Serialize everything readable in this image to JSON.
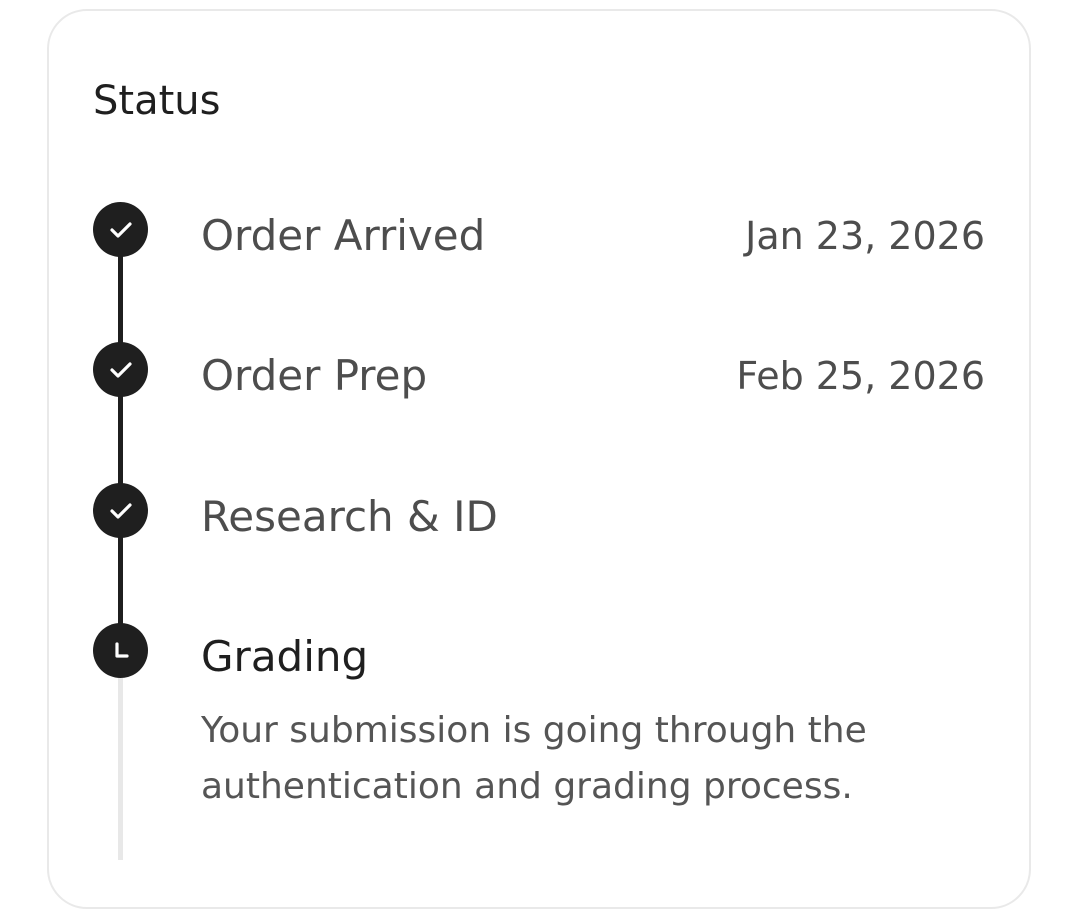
{
  "status": {
    "title": "Status",
    "steps": [
      {
        "label": "Order Arrived",
        "date": "Jan 23, 2026",
        "state": "completed",
        "icon": "check-icon"
      },
      {
        "label": "Order Prep",
        "date": "Feb 25, 2026",
        "state": "completed",
        "icon": "check-icon"
      },
      {
        "label": "Research & ID",
        "date": "",
        "state": "completed",
        "icon": "check-icon"
      },
      {
        "label": "Grading",
        "date": "",
        "state": "current",
        "icon": "clock-icon",
        "description": "Your submission is going through the authentication and grading process."
      }
    ]
  },
  "colors": {
    "completed": "#1f1f1f",
    "rail_pending": "#e8e8e8"
  }
}
